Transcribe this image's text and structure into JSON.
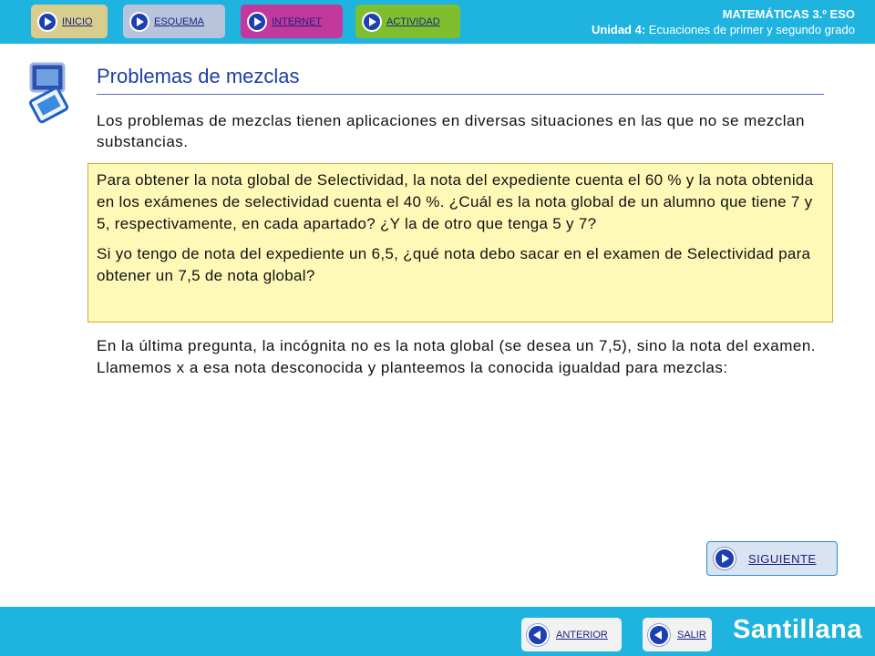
{
  "nav": {
    "inicio": "INICIO",
    "esquema": "ESQUEMA",
    "internet": "INTERNET",
    "actividad": "ACTIVIDAD"
  },
  "subject": {
    "course": "MATEMÁTICAS 3.º ESO",
    "unit_label": "Unidad 4:",
    "unit_title": "Ecuaciones de primer y segundo grado"
  },
  "page": {
    "title": "Problemas de mezclas",
    "intro": "Los problemas de mezclas tienen aplicaciones en diversas situaciones en las que no se mezclan substancias.",
    "problem_p1": "Para obtener la nota global de Selectividad, la nota del expediente cuenta el 60 % y la nota obtenida en los exámenes de selectividad cuenta el 40 %. ¿Cuál es la nota global de un alumno que tiene 7 y 5, respectivamente, en cada apartado? ¿Y la de otro que tenga 5 y 7?",
    "problem_p2": "Si yo tengo de nota del expediente un 6,5, ¿qué nota debo sacar en el examen de Selectividad para obtener un 7,5 de nota global?",
    "explanation": "En la última pregunta, la incógnita no es la nota global (se desea un 7,5), sino la nota del examen. Llamemos x a esa nota desconocida y planteemos la conocida igualdad para mezclas:"
  },
  "footer_nav": {
    "siguiente": "SIGUIENTE",
    "anterior": "ANTERIOR",
    "salir": "SALIR"
  },
  "brand": "Santillana",
  "icons": {
    "nav": "play-arrow-icon",
    "back": "back-arrow-icon",
    "decor": "screen-document-icon"
  },
  "colors": {
    "bar": "#1fb3e0",
    "title": "#1a3fa8",
    "box_bg": "#fff9b8",
    "box_border": "#d8a73a"
  }
}
